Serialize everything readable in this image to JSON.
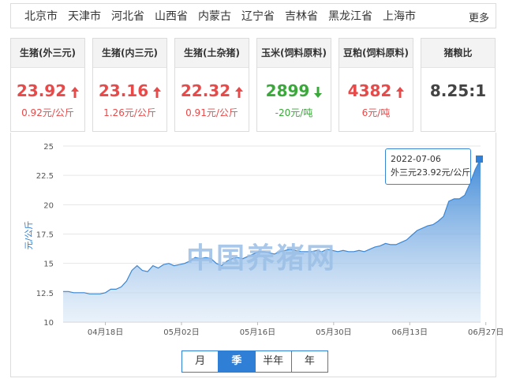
{
  "regions": {
    "items": [
      "北京市",
      "天津市",
      "河北省",
      "山西省",
      "内蒙古",
      "辽宁省",
      "吉林省",
      "黑龙江省",
      "上海市"
    ],
    "more": "更多"
  },
  "cards": [
    {
      "title": "生猪(外三元)",
      "price": "23.92",
      "change": "0.92元/公斤",
      "trend": "up"
    },
    {
      "title": "生猪(内三元)",
      "price": "23.16",
      "change": "1.26元/公斤",
      "trend": "up"
    },
    {
      "title": "生猪(土杂猪)",
      "price": "22.32",
      "change": "0.91元/公斤",
      "trend": "up"
    },
    {
      "title": "玉米(饲料原料)",
      "price": "2899",
      "change": "-20元/吨",
      "trend": "down"
    },
    {
      "title": "豆粕(饲料原料)",
      "price": "4382",
      "change": "6元/吨",
      "trend": "up"
    },
    {
      "title": "猪粮比",
      "price": "8.25:1",
      "change": "",
      "trend": "none"
    }
  ],
  "colors": {
    "up": "#e84a4a",
    "down": "#3aa83a",
    "accent": "#2f7fd6"
  },
  "watermark": "中国养猪网",
  "tooltip": {
    "date": "2022-07-06",
    "text": "外三元23.92元/公斤"
  },
  "range_tabs": {
    "items": [
      "月",
      "季",
      "半年",
      "年"
    ],
    "active": "季"
  },
  "chart_data": {
    "type": "area",
    "ylabel": "元/公斤",
    "xlabel": "",
    "title": "",
    "ylim": [
      10,
      25
    ],
    "yticks": [
      10,
      12.5,
      15,
      17.5,
      20,
      22.5,
      25
    ],
    "xticks": [
      "04月18日",
      "05月02日",
      "05月16日",
      "05月30日",
      "06月13日",
      "06月27日"
    ],
    "grid": true,
    "series": [
      {
        "values": [
          12.6,
          12.6,
          12.5,
          12.5,
          12.5,
          12.4,
          12.4,
          12.4,
          12.5,
          12.8,
          12.8,
          13.0,
          13.5,
          14.4,
          14.8,
          14.4,
          14.3,
          14.8,
          14.6,
          14.9,
          15.0,
          14.8,
          14.9,
          15.0,
          15.2,
          15.5,
          15.4,
          15.5,
          15.4,
          15.0,
          14.8,
          15.2,
          15.4,
          15.5,
          15.4,
          15.6,
          15.8,
          16.0,
          16.0,
          15.9,
          15.8,
          16.0,
          16.1,
          16.2,
          16.1,
          16.0,
          16.0,
          16.0,
          16.1,
          16.0,
          16.2,
          16.1,
          16.0,
          16.1,
          16.0,
          16.0,
          16.1,
          16.0,
          16.2,
          16.4,
          16.5,
          16.7,
          16.6,
          16.6,
          16.8,
          17.0,
          17.4,
          17.8,
          18.0,
          18.2,
          18.3,
          18.6,
          19.0,
          20.3,
          20.5,
          20.5,
          20.8,
          21.8,
          23.0,
          23.9
        ]
      }
    ]
  }
}
